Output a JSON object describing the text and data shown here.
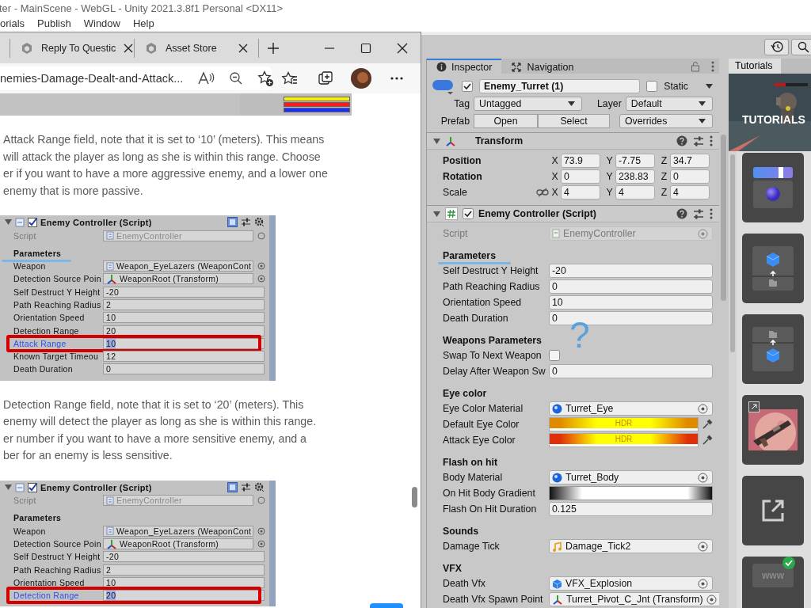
{
  "app": {
    "title": "ter - MainScene - WebGL - Unity 2021.3.8f1 Personal <DX11>",
    "menu": [
      "orials",
      "Publish",
      "Window",
      "Help"
    ]
  },
  "browser": {
    "tabs": [
      {
        "title": "Reply To Questic",
        "selected": false
      },
      {
        "title": "Asset Store",
        "selected": false
      }
    ],
    "address": "nemies-Damage-Dealt-and-Attack...",
    "article": [
      {
        "kind": "strip",
        "bars": [
          {
            "color": "#ffee00"
          },
          {
            "color": "#ff1a1a"
          },
          {
            "color": "#1a2cff"
          }
        ]
      },
      {
        "kind": "paragraph",
        "lines": [
          "Attack Range field, note that it is set to ‘10’ (meters). This means",
          "will attack the player as long as she is within this range. Choose",
          "er if you want to have a more aggressive enemy, and a lower one",
          "enemy that is more passive."
        ]
      },
      {
        "kind": "figure",
        "title": "Enemy Controller (Script)",
        "enabled": true,
        "rows": [
          {
            "kind": "script",
            "label": "Script",
            "value": "EnemyController"
          },
          {
            "kind": "header",
            "label": "Parameters",
            "underlined": true
          },
          {
            "kind": "reference",
            "label": "Weapon",
            "value": "Weapon_EyeLazers (WeaponCont"
          },
          {
            "kind": "transform",
            "label": "Detection Source Poin",
            "value": "WeaponRoot (Transform)"
          },
          {
            "kind": "text",
            "label": "Self Destruct Y Height",
            "value": "-20",
            "highlighted": false
          },
          {
            "kind": "text",
            "label": "Path Reaching Radius",
            "value": "2",
            "highlighted": false
          },
          {
            "kind": "text",
            "label": "Orientation Speed",
            "value": "10",
            "highlighted": false
          },
          {
            "kind": "text",
            "label": "Detection Range",
            "value": "20",
            "highlighted": false
          },
          {
            "kind": "text",
            "label": "Attack Range",
            "value": "10",
            "highlighted": true
          },
          {
            "kind": "text",
            "label": "Known Target Timeou",
            "value": "12",
            "highlighted": false
          },
          {
            "kind": "text",
            "label": "Death Duration",
            "value": "0",
            "highlighted": false
          }
        ]
      },
      {
        "kind": "paragraph",
        "lines": [
          "Detection Range field, note that it is set to ‘20’ (meters). This",
          "enemy will detect the player as long as she is within this range.",
          "er number if you want to have a more sensitive enemy, and a",
          "ber for an enemy is less sensitive."
        ]
      },
      {
        "kind": "figure",
        "title": "Enemy Controller (Script)",
        "enabled": true,
        "rows": [
          {
            "kind": "script",
            "label": "Script",
            "value": "EnemyController"
          },
          {
            "kind": "header",
            "label": "Parameters",
            "underlined": false
          },
          {
            "kind": "reference",
            "label": "Weapon",
            "value": "Weapon_EyeLazers (WeaponCont"
          },
          {
            "kind": "transform",
            "label": "Detection Source Poin",
            "value": "WeaponRoot (Transform)"
          },
          {
            "kind": "text",
            "label": "Self Destruct Y Height",
            "value": "-20",
            "highlighted": false
          },
          {
            "kind": "text",
            "label": "Path Reaching Radius",
            "value": "2",
            "highlighted": false
          },
          {
            "kind": "text",
            "label": "Orientation Speed",
            "value": "10",
            "highlighted": false
          },
          {
            "kind": "text",
            "label": "Detection Range",
            "value": "20",
            "highlighted": true
          }
        ]
      }
    ]
  },
  "inspector": {
    "tabs": [
      {
        "label": "Inspector",
        "selected": true
      },
      {
        "label": "Navigation",
        "selected": false
      }
    ],
    "object": {
      "active": true,
      "name": "Enemy_Turret (1)",
      "static": false,
      "static_label": "Static",
      "tag_label": "Tag",
      "tag": "Untagged",
      "layer_label": "Layer",
      "layer": "Default",
      "prefab_label": "Prefab",
      "prefab_buttons": [
        "Open",
        "Select"
      ],
      "overrides": "Overrides"
    },
    "transform": {
      "title": "Transform",
      "rows": [
        {
          "kind": "vector",
          "label": "Position",
          "overridden": true,
          "fields": [
            {
              "axis": "X",
              "value": "73.9"
            },
            {
              "axis": "Y",
              "value": "-7.75"
            },
            {
              "axis": "Z",
              "value": "34.7"
            }
          ]
        },
        {
          "kind": "vector",
          "label": "Rotation",
          "overridden": true,
          "fields": [
            {
              "axis": "X",
              "value": "0"
            },
            {
              "axis": "Y",
              "value": "238.83"
            },
            {
              "axis": "Z",
              "value": "0"
            }
          ]
        },
        {
          "kind": "scale",
          "label": "Scale",
          "overridden": false,
          "fields": [
            {
              "axis": "X",
              "value": "4"
            },
            {
              "axis": "Y",
              "value": "4"
            },
            {
              "axis": "Z",
              "value": "4"
            }
          ]
        }
      ]
    },
    "component": {
      "title": "Enemy Controller (Script)",
      "enabled": true,
      "rows": [
        {
          "kind": "script",
          "label": "Script",
          "value": "EnemyController"
        },
        {
          "kind": "header",
          "label": "Parameters",
          "underlined": true
        },
        {
          "kind": "text",
          "label": "Self Destruct Y Height",
          "value": "-20"
        },
        {
          "kind": "text",
          "label": "Path Reaching Radius",
          "value": "0"
        },
        {
          "kind": "text",
          "label": "Orientation Speed",
          "value": "10"
        },
        {
          "kind": "text",
          "label": "Death Duration",
          "value": "0"
        },
        {
          "kind": "header",
          "label": "Weapons Parameters",
          "underlined": false
        },
        {
          "kind": "checkbox",
          "label": "Swap To Next Weapon",
          "checked": false
        },
        {
          "kind": "text",
          "label": "Delay After Weapon Sw",
          "value": "0"
        },
        {
          "kind": "header",
          "label": "Eye color",
          "underlined": false
        },
        {
          "kind": "material",
          "label": "Eye Color Material",
          "value": "Turret_Eye"
        },
        {
          "kind": "color",
          "label": "Default Eye Color",
          "value": "HDR",
          "color": "#e08a00"
        },
        {
          "kind": "color",
          "label": "Attack Eye Color",
          "value": "HDR",
          "color": "#e0300a"
        },
        {
          "kind": "header",
          "label": "Flash on hit",
          "underlined": false
        },
        {
          "kind": "material",
          "label": "Body Material",
          "value": "Turret_Body"
        },
        {
          "kind": "gradient",
          "label": "On Hit Body Gradient"
        },
        {
          "kind": "text",
          "label": "Flash On Hit Duration",
          "value": "0.125"
        },
        {
          "kind": "header",
          "label": "Sounds",
          "underlined": false
        },
        {
          "kind": "audio",
          "label": "Damage Tick",
          "value": "Damage_Tick2"
        },
        {
          "kind": "header",
          "label": "VFX",
          "underlined": false
        },
        {
          "kind": "prefab",
          "label": "Death Vfx",
          "value": "VFX_Explosion"
        },
        {
          "kind": "transform",
          "label": "Death Vfx Spawn Point",
          "value": "Turret_Pivot_C_Jnt (Transform)"
        }
      ]
    },
    "annotation": "?"
  },
  "tutorials": {
    "tab": "Tutorials",
    "banner": "TUTORIALS",
    "cards": [
      {
        "kind": "slider"
      },
      {
        "kind": "upload"
      },
      {
        "kind": "download"
      },
      {
        "kind": "picture"
      },
      {
        "kind": "link"
      },
      {
        "kind": "web",
        "label": "www",
        "completed": true
      }
    ]
  }
}
